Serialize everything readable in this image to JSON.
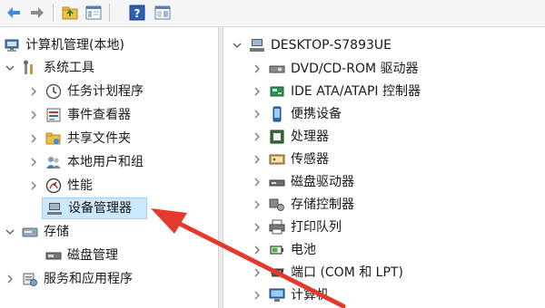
{
  "tree_left": {
    "root": "计算机管理(本地)",
    "system_tools": "系统工具",
    "task_scheduler": "任务计划程序",
    "event_viewer": "事件查看器",
    "shared_folders": "共享文件夹",
    "local_users": "本地用户和组",
    "performance": "性能",
    "device_manager": "设备管理器",
    "storage": "存储",
    "disk_management": "磁盘管理",
    "services_apps": "服务和应用程序"
  },
  "tree_right": {
    "computer_name": "DESKTOP-S7893UE",
    "items": [
      "DVD/CD-ROM 驱动器",
      "IDE ATA/ATAPI 控制器",
      "便携设备",
      "处理器",
      "传感器",
      "磁盘驱动器",
      "存储控制器",
      "打印队列",
      "电池",
      "端口 (COM 和 LPT)",
      "计算机"
    ]
  },
  "colors": {
    "selection": "#cce8ff",
    "annotation_arrow": "#e23b2e"
  },
  "icons": {
    "toolbar": [
      "back-arrow-icon",
      "forward-arrow-icon",
      "up-folder-icon",
      "show-hide-tree-icon",
      "help-icon",
      "properties-icon"
    ]
  }
}
